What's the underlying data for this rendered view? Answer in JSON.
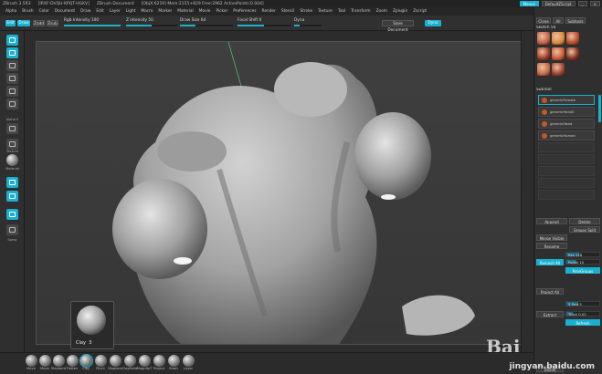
{
  "title_bar": {
    "items": [
      "ZBrush 3.5R3",
      "[IRXF-DVQU-KPQT-HGKV]",
      "ZBrush Document",
      "[ObjX:6219] Mem:2155+829 Free:2962 ActivePoints:0.004]"
    ],
    "menus_btn": "Menus",
    "script_btn": "DefaultZScript"
  },
  "menu_bar": [
    "Alpha",
    "Brush",
    "Color",
    "Document",
    "Draw",
    "Edit",
    "Layer",
    "Light",
    "Macro",
    "Marker",
    "Material",
    "Movie",
    "Picker",
    "Preferences",
    "Render",
    "Stencil",
    "Stroke",
    "Texture",
    "Tool",
    "Transform",
    "Zoom",
    "Zplugin",
    "Zscript"
  ],
  "top_shelf": {
    "edit": "Edit",
    "draw": "Draw",
    "zadd": "Zadd",
    "zsub": "Zsub",
    "rgb_intensity": "Rgb Intensity 100",
    "z_intensity": "Z Intensity 50",
    "draw_size": "Draw Size 64",
    "focal_shift": "Focal Shift 0",
    "dynamic": "Dyna",
    "save_document": "Save Document",
    "dynamesh": "Dyna"
  },
  "left_tools": {
    "alpha_label": "Alpha 0",
    "texture_label": "Texture",
    "material_label": "Material",
    "spray_label": "Spray"
  },
  "brush_popup": {
    "name": "Clay",
    "number": "3"
  },
  "right_panel": {
    "header_btns": [
      "Clone",
      "All",
      "Subtools"
    ],
    "sketch_label": "Sketch 50",
    "thumbs": [
      {
        "label": "Sketch_3",
        "color": "#c0604a"
      },
      {
        "label": "SphereBrush",
        "color": "#d88a3a"
      },
      {
        "label": "Sphere3D",
        "color": "#b64a2a"
      },
      {
        "label": "Cylinder3D",
        "color": "#9a3a2a"
      },
      {
        "label": "PolyMesh3D",
        "color": "#c85a34"
      },
      {
        "label": "SimpleBrush",
        "color": "#7b3020"
      },
      {
        "label": "genericFemale",
        "color": "#c26a48"
      },
      {
        "label": "PM3D_Sphere",
        "color": "#9a4030"
      }
    ],
    "subtool_header": "SubTool",
    "subtools": [
      "genericFemale",
      "genericHead2",
      "genericHead",
      "genericHuman"
    ],
    "append": "Append",
    "delete": "Delete",
    "split_btn": "Groups Split",
    "merge_btn": "Merge Visible",
    "rename": "Rename",
    "extract_label": "Extract",
    "thick": "Thick 0.02",
    "res": "Res 128",
    "polish": "Polish 10",
    "divide": "Divide",
    "smooth": "S Smt 5",
    "remesh_btn": "Remesh All",
    "project_btn": "Project All",
    "polygroups": "PolyGroups",
    "refresh": "Refresh"
  },
  "bottom_brushes": [
    "Move",
    "Move",
    "Standard",
    "Flatten",
    "Clay",
    "Pinch",
    "Displace",
    "ClayBuild",
    "MagnifyT",
    "Project",
    "Slash",
    "Layer"
  ],
  "watermark": "jingyan.baidu.com",
  "colors": {
    "accent": "#1ab0d0",
    "panel": "#2f2f2f",
    "canvas": "#3f3f3f"
  }
}
